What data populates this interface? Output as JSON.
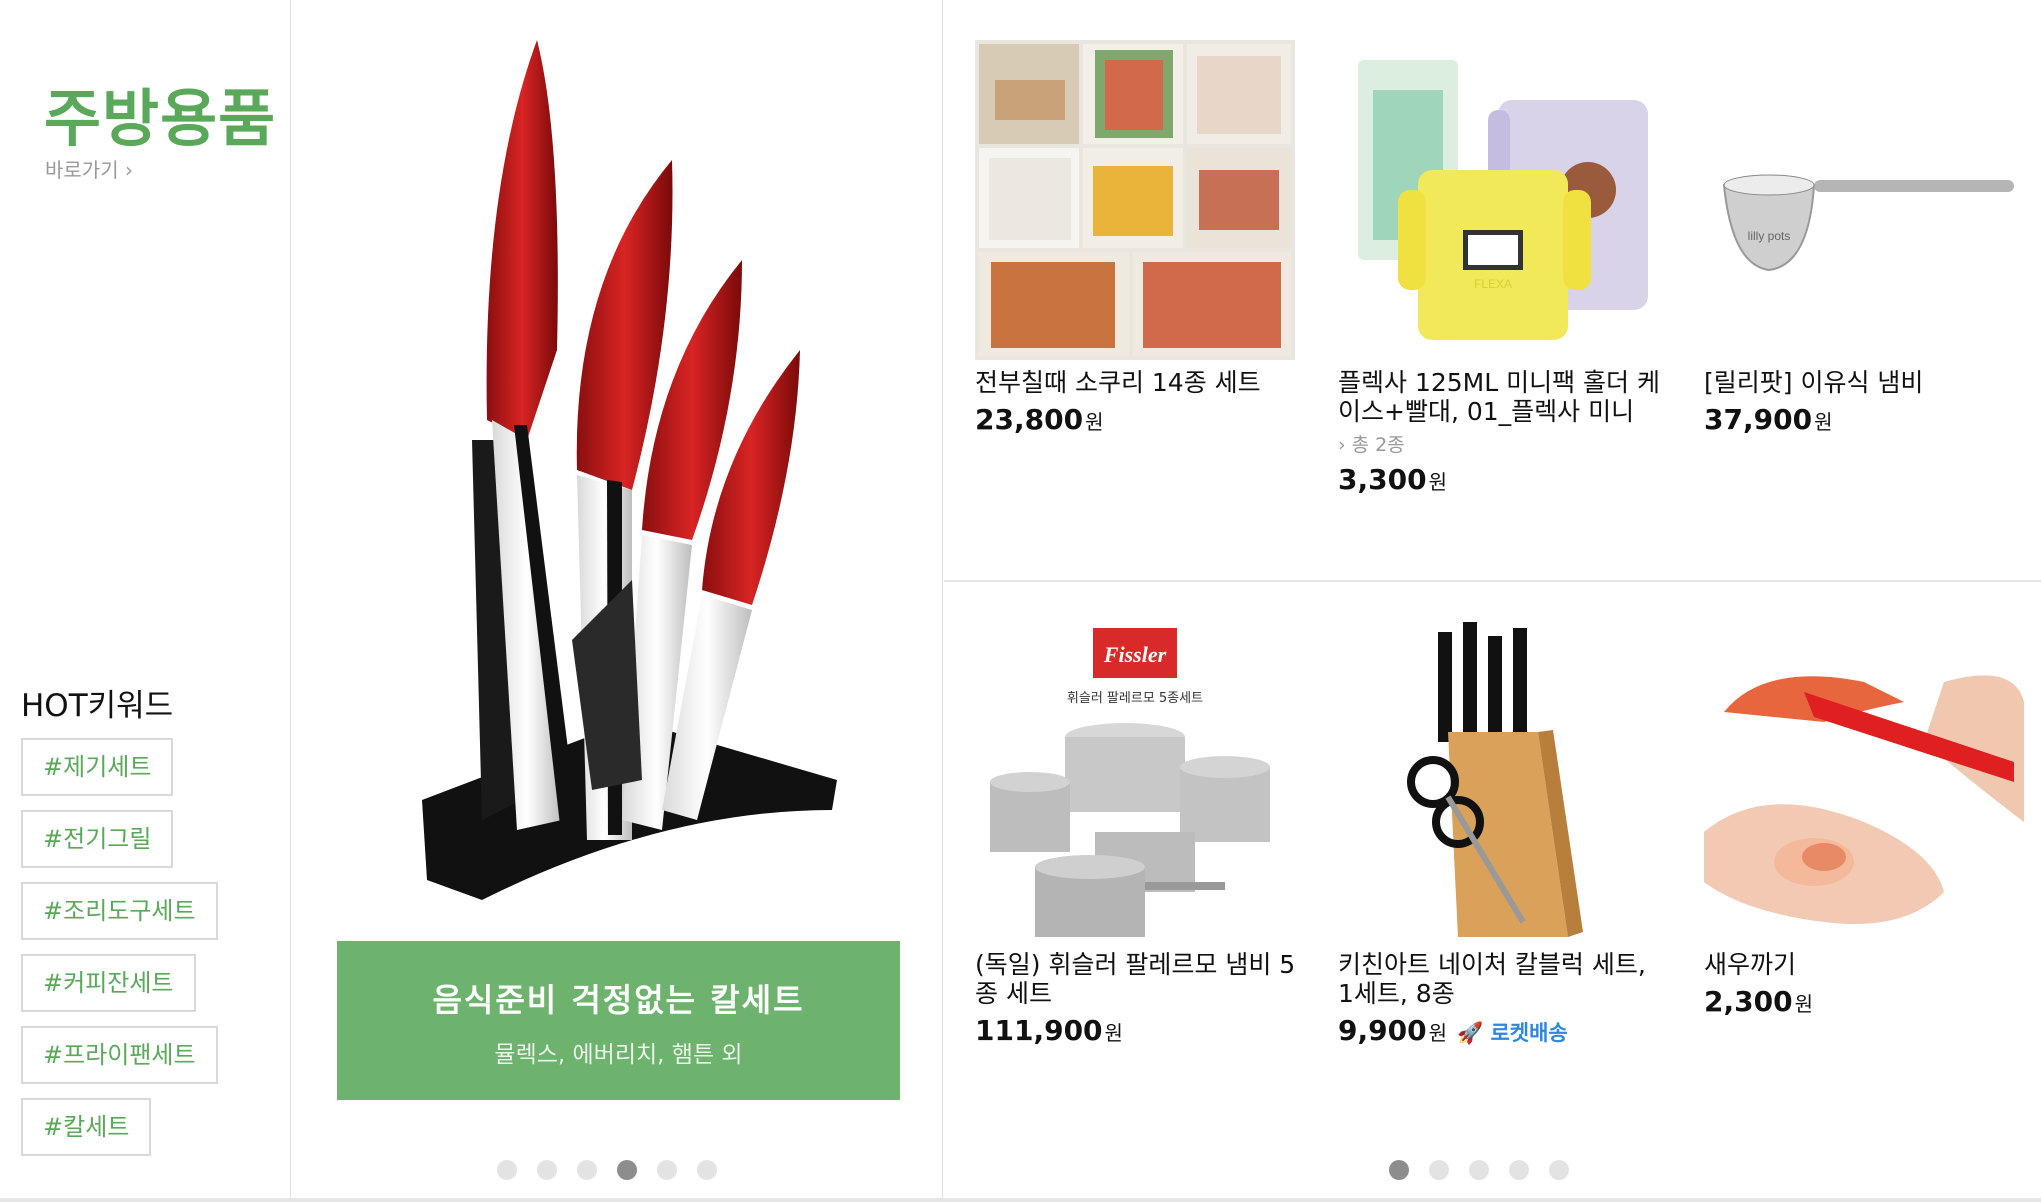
{
  "category": {
    "title": "주방용품",
    "shortcut": "바로가기 ›"
  },
  "hot_keywords": {
    "title": "HOT키워드",
    "items": [
      "#제기세트",
      "#전기그릴",
      "#조리도구세트",
      "#커피잔세트",
      "#프라이팬세트",
      "#칼세트"
    ]
  },
  "banner": {
    "title": "음식준비 걱정없는 칼세트",
    "subtitle": "뮬렉스, 에버리치, 햄튼 외",
    "page_count": 6,
    "active_page": 4
  },
  "products": [
    {
      "name": "전부칠때 소쿠리 14종 세트",
      "price": "23,800",
      "unit": "원"
    },
    {
      "name": "플렉사 125ML 미니팩 홀더 케이스+빨대, 01_플렉사 미니",
      "option": "› 총 2종",
      "price": "3,300",
      "unit": "원"
    },
    {
      "name": "[릴리팟] 이유식 냄비",
      "price": "37,900",
      "unit": "원"
    },
    {
      "name": "(독일) 휘슬러 팔레르모 냄비 5종 세트",
      "price": "111,900",
      "unit": "원"
    },
    {
      "name": "키친아트 네이처 칼블럭 세트, 1세트, 8종",
      "price": "9,900",
      "unit": "원",
      "badge": "🚀 로켓배송"
    },
    {
      "name": "새우까기",
      "price": "2,300",
      "unit": "원"
    }
  ],
  "product_pager": {
    "page_count": 5,
    "active_page": 1
  },
  "images": {
    "p4_brand": "Fissler",
    "p4_caption": "휘슬러 팔레르모 5종세트",
    "p3_brand": "lilly pots",
    "p2_brand": "FLEXA"
  },
  "colors": {
    "accent": "#5aa85a",
    "banner": "#6db36d",
    "rocket": "#2e86de"
  }
}
